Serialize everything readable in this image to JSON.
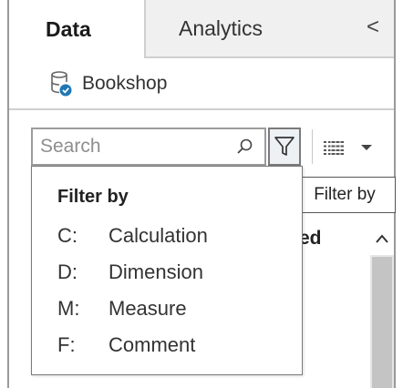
{
  "tabs": {
    "data_label": "Data",
    "analytics_label": "Analytics",
    "collapse_glyph": "<"
  },
  "datasource": {
    "name": "Bookshop",
    "icon": "database-check-icon"
  },
  "search": {
    "placeholder": "Search",
    "value": ""
  },
  "toolbar": {
    "filter_icon": "funnel-icon",
    "view_icon": "list-view-icon",
    "dropdown_icon": "caret-down-icon"
  },
  "tooltip": {
    "text": "Filter by"
  },
  "filter_menu": {
    "title": "Filter by",
    "items": [
      {
        "key": "C:",
        "label": "Calculation"
      },
      {
        "key": "D:",
        "label": "Dimension"
      },
      {
        "key": "M:",
        "label": "Measure"
      },
      {
        "key": "F:",
        "label": "Comment"
      }
    ]
  },
  "behind": {
    "partial_text": "ed"
  },
  "colors": {
    "accent_blue": "#1f77b4",
    "border_gray": "#9c9c9c",
    "scroll_thumb": "#c4c4c4"
  }
}
